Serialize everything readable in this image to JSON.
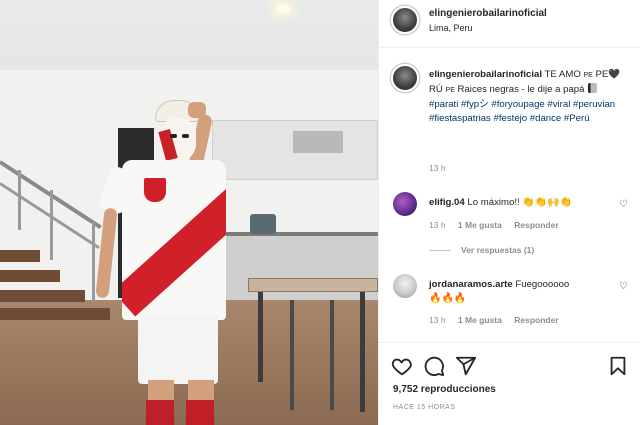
{
  "post": {
    "username": "elingenierobailarinoficial",
    "location": "Lima, Peru",
    "caption_text_1": "TE AMO",
    "caption_small_1": "PE",
    "caption_text_2": "PE",
    "caption_text_3": "RÚ",
    "caption_small_2": "PE",
    "caption_text_4": "Raices negras - le dije a papá",
    "hashtags": "#parati #fypシ #foryoupage #viral #peruvian #fiestaspatrias #festejo #dance #Perú",
    "caption_time": "13 h",
    "views": "9,752 reproducciones",
    "posted_ago": "HACE 15 HORAS"
  },
  "comments": [
    {
      "username": "elifig.04",
      "text": "Lo máximo!!",
      "emojis": "👏👏🙌👏",
      "time": "13 h",
      "likes": "1 Me gusta",
      "reply_label": "Responder",
      "view_replies": "Ver respuestas (1)"
    },
    {
      "username": "jordanaramos.arte",
      "text": "Fuegoooooo",
      "emojis": "🔥🔥🔥",
      "time": "13 h",
      "likes": "1 Me gusta",
      "reply_label": "Responder"
    }
  ],
  "icons": {
    "like": "heart-icon",
    "comment": "comment-icon",
    "share": "share-icon",
    "save": "bookmark-icon"
  },
  "colors": {
    "link": "#00376b",
    "muted": "#8e8e8e",
    "text": "#262626",
    "peru_red": "#d0212b"
  }
}
